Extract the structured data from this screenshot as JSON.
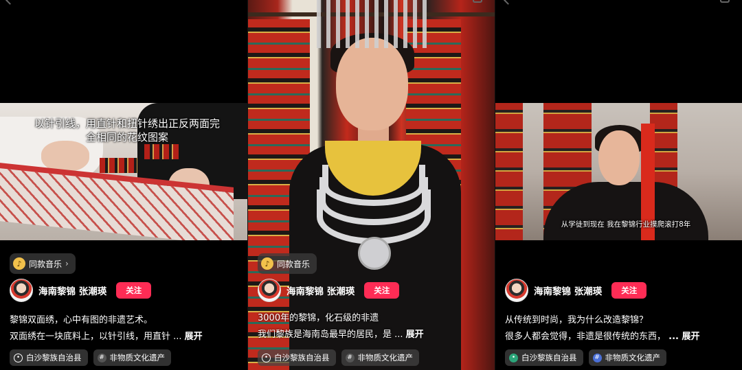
{
  "panels": [
    {
      "caption": [
        "以针引线，用直针和扭针绣出正反两面完",
        "全相同的花纹图案"
      ],
      "music": "同款音乐",
      "author": "海南黎锦 张潮瑛",
      "follow": "关注",
      "desc": [
        "黎锦双面绣，心中有图的非遗艺术。",
        "双面绣在一块底料上，以针引线，用直针 ..."
      ],
      "more": "展开",
      "tags": [
        {
          "icon": "location-pin-icon",
          "label": "白沙黎族自治县"
        },
        {
          "icon": "hashtag-icon",
          "label": "非物质文化遗产"
        }
      ]
    },
    {
      "music": "同款音乐",
      "author": "海南黎锦 张潮瑛",
      "follow": "关注",
      "desc": [
        "3000年的黎锦，化石级的非遗",
        "我们黎族是海南岛最早的居民，是 ..."
      ],
      "more": "展开",
      "tags": [
        {
          "icon": "location-pin-icon",
          "label": "白沙黎族自治县"
        },
        {
          "icon": "hashtag-icon",
          "label": "非物质文化遗产"
        }
      ]
    },
    {
      "caption": [
        "从学徒到现在 我在黎锦行业摸爬滚打8年"
      ],
      "author": "海南黎锦 张潮瑛",
      "follow": "关注",
      "desc": [
        "从传统到时尚，我为什么改造黎锦？",
        "很多人都会觉得，非遗是很传统的东西，"
      ],
      "more": "... 展开",
      "tags": [
        {
          "icon": "location-pin-icon",
          "label": "白沙黎族自治县"
        },
        {
          "icon": "hashtag-icon",
          "label": "非物质文化遗产"
        }
      ]
    }
  ],
  "colors": {
    "follow": "#fe2c55",
    "music_icon": "#f2c14b",
    "location_green": "#2ca57a",
    "hashtag_blue": "#4a6fd6"
  }
}
